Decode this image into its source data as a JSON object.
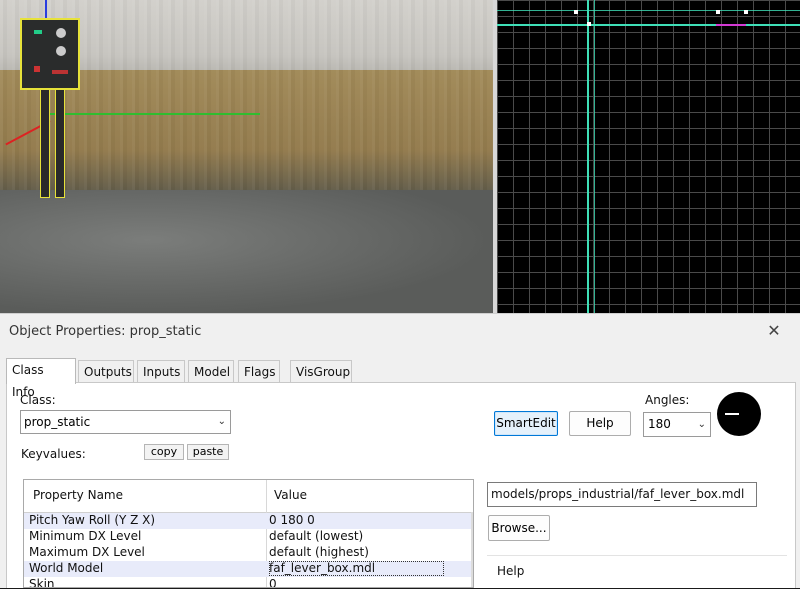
{
  "dialog": {
    "title": "Object Properties: prop_static",
    "close_glyph": "✕"
  },
  "tabs": [
    "Class Info",
    "Outputs",
    "Inputs",
    "Model",
    "Flags",
    "VisGroup"
  ],
  "active_tab": "Class Info",
  "class_info": {
    "class_label": "Class:",
    "class_value": "prop_static",
    "keyvalues_label": "Keyvalues:",
    "copy_label": "copy",
    "paste_label": "paste",
    "smartedit_label": "SmartEdit",
    "help_label": "Help",
    "angles_label": "Angles:",
    "angles_value": "180"
  },
  "properties": {
    "headers": {
      "name": "Property Name",
      "value": "Value"
    },
    "rows": [
      {
        "name": "Pitch Yaw Roll (Y Z X)",
        "value": "0 180 0"
      },
      {
        "name": "Minimum DX Level",
        "value": "default (lowest)"
      },
      {
        "name": "Maximum DX Level",
        "value": "default (highest)"
      },
      {
        "name": "World Model",
        "value": "faf_lever_box.mdl"
      },
      {
        "name": "Skin",
        "value": "0"
      }
    ]
  },
  "editor": {
    "model_path": "models/props_industrial/faf_lever_box.mdl",
    "browse_label": "Browse...",
    "help_label": "Help"
  },
  "colors": {
    "selection_outline": "#e7e23a",
    "grid_line": "#3fe0b8",
    "smartedit_active": "#0078d7"
  }
}
